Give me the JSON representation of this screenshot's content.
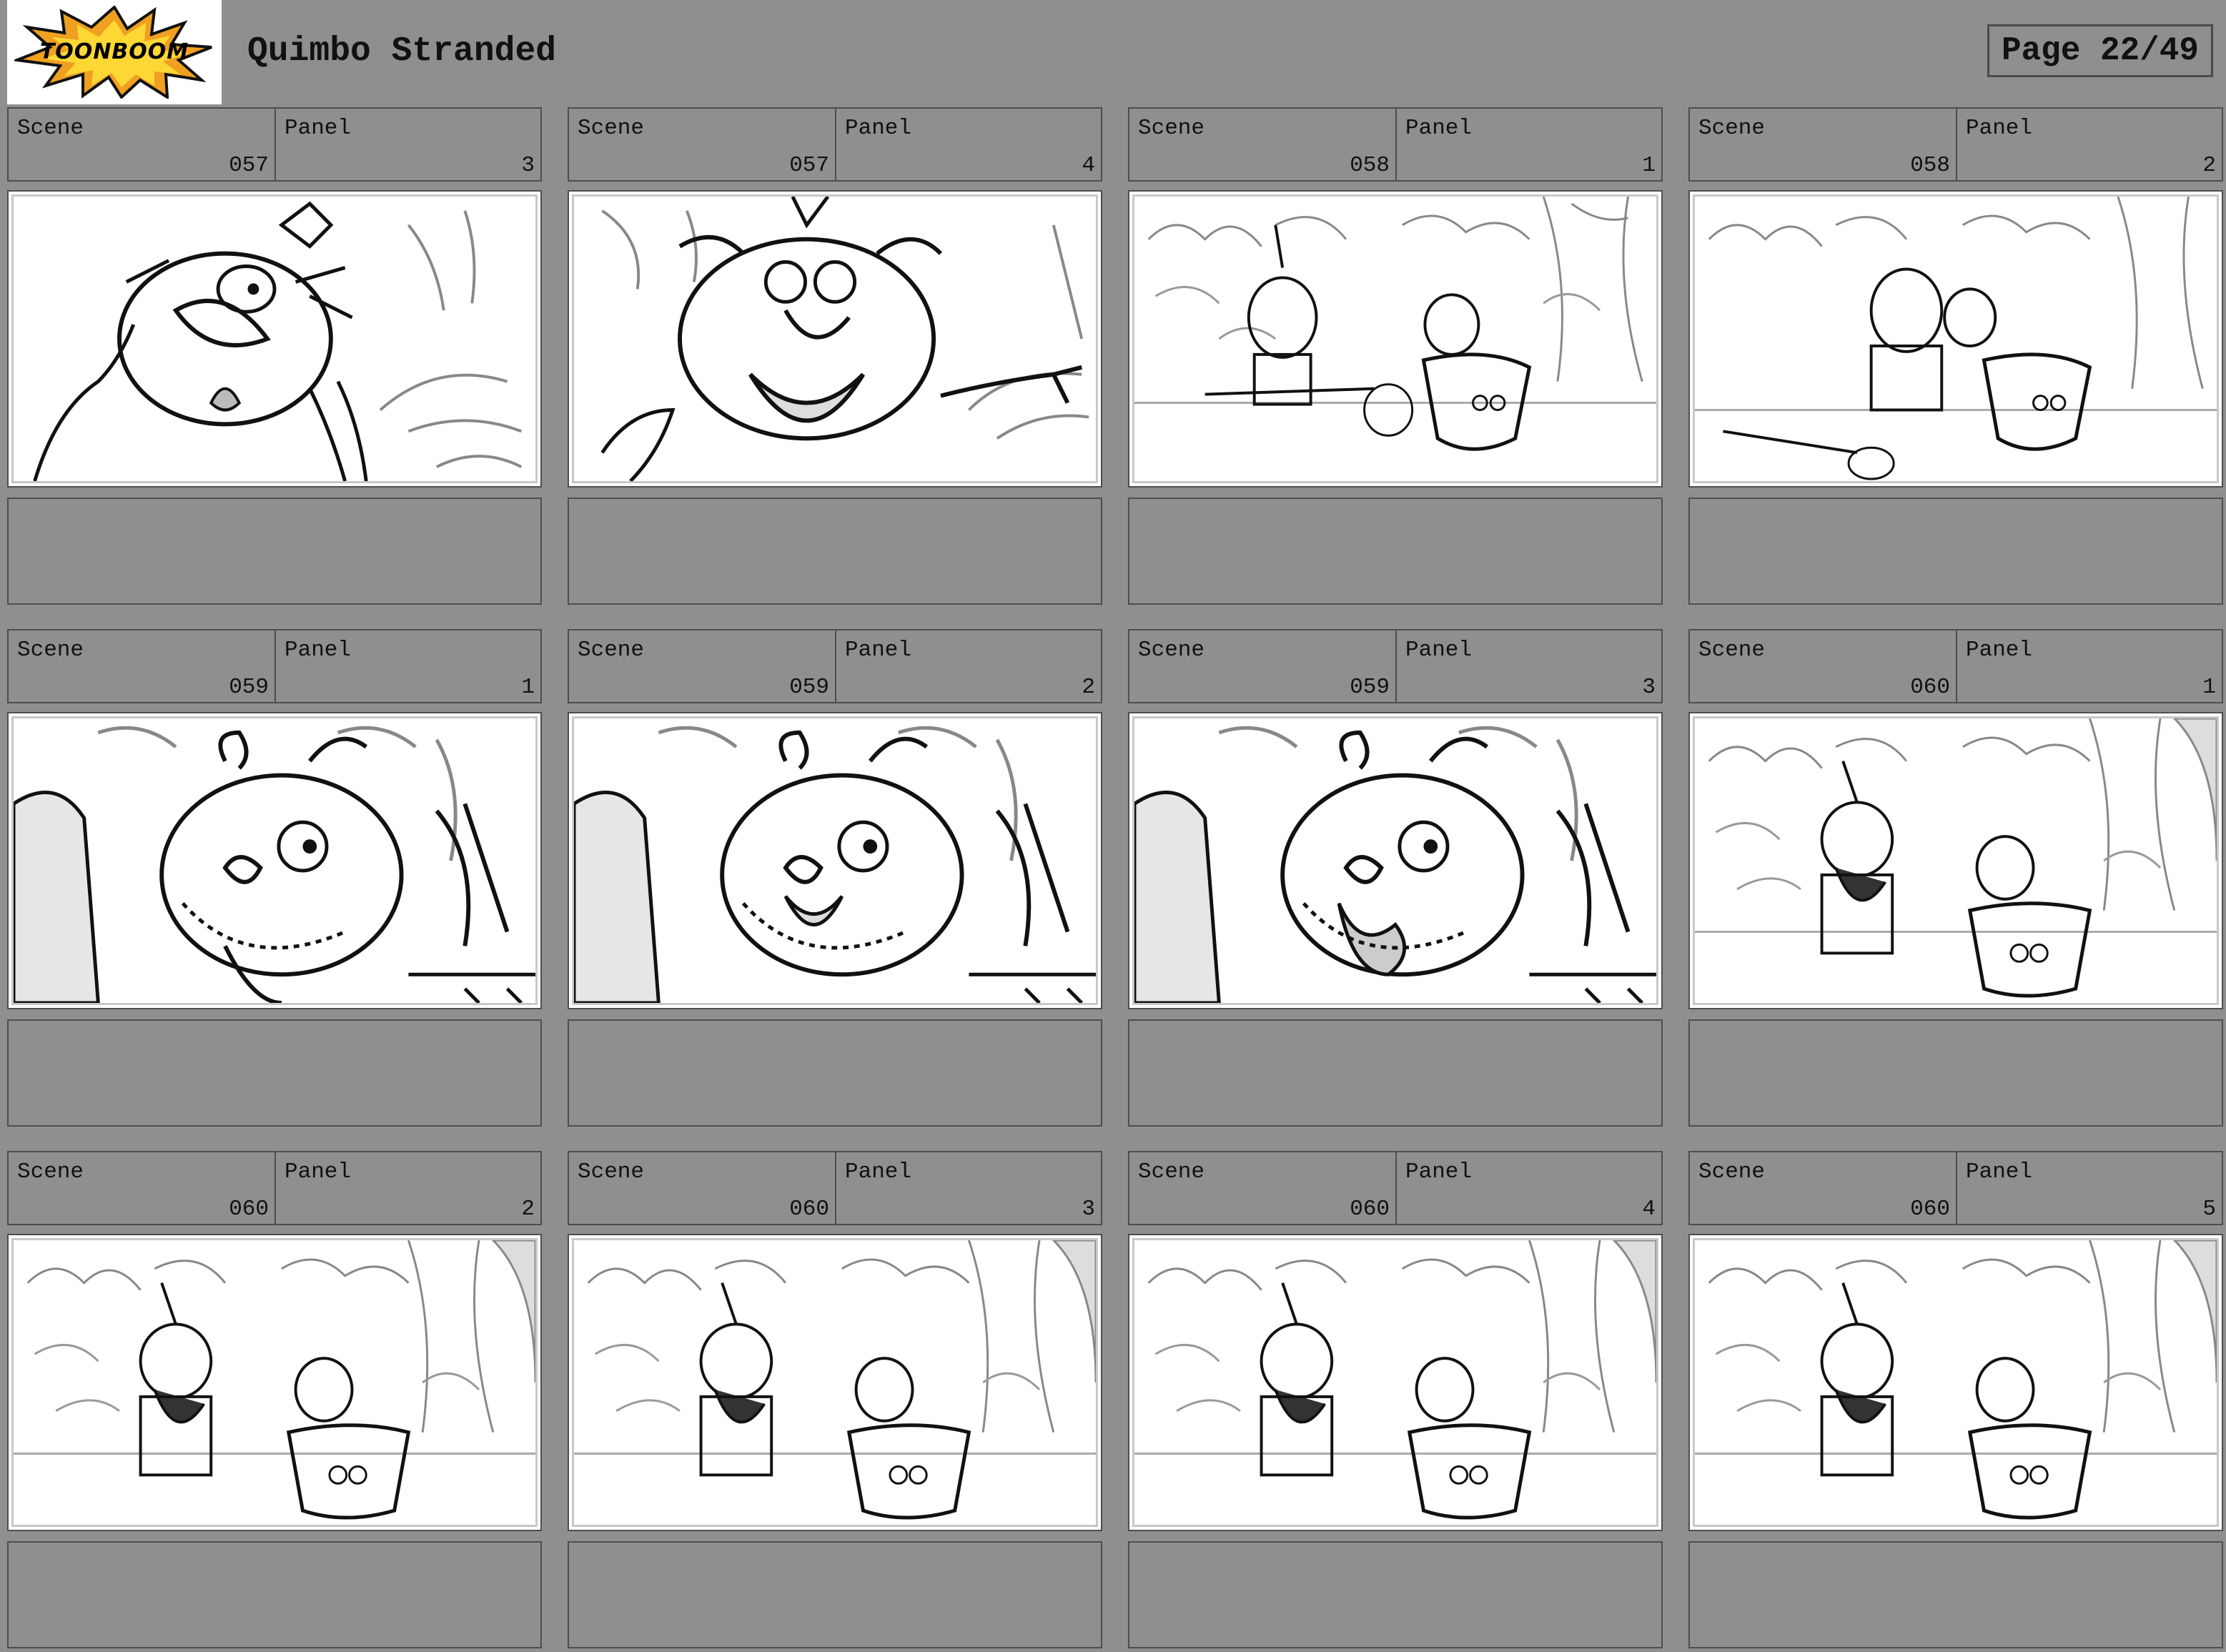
{
  "logo": {
    "text": "TOONBOOM",
    "colors": {
      "burst_outer": "#f0a020",
      "burst_inner": "#fdd835",
      "burst_outline": "#111111"
    }
  },
  "header": {
    "title": "Quimbo Stranded",
    "page_indicator": "Page 22/49"
  },
  "labels": {
    "scene": "Scene",
    "panel": "Panel"
  },
  "panels": [
    {
      "scene": "057",
      "panel": "3",
      "sketch": "closeup-surprised"
    },
    {
      "scene": "057",
      "panel": "4",
      "sketch": "closeup-shouting"
    },
    {
      "scene": "058",
      "panel": "1",
      "sketch": "wide-jungle-net"
    },
    {
      "scene": "058",
      "panel": "2",
      "sketch": "wide-jungle-grab"
    },
    {
      "scene": "059",
      "panel": "1",
      "sketch": "closeup-bearded"
    },
    {
      "scene": "059",
      "panel": "2",
      "sketch": "closeup-bearded-open"
    },
    {
      "scene": "059",
      "panel": "3",
      "sketch": "closeup-bearded-tongue"
    },
    {
      "scene": "060",
      "panel": "1",
      "sketch": "wide-jungle-pot"
    },
    {
      "scene": "060",
      "panel": "2",
      "sketch": "wide-jungle-pot"
    },
    {
      "scene": "060",
      "panel": "3",
      "sketch": "wide-jungle-pot"
    },
    {
      "scene": "060",
      "panel": "4",
      "sketch": "wide-jungle-pot"
    },
    {
      "scene": "060",
      "panel": "5",
      "sketch": "wide-jungle-pot"
    }
  ],
  "colors": {
    "page_background": "#8f8f8f",
    "border": "#4e4e4e",
    "sketch_line": "#111111",
    "sketch_background_line": "#888888"
  }
}
